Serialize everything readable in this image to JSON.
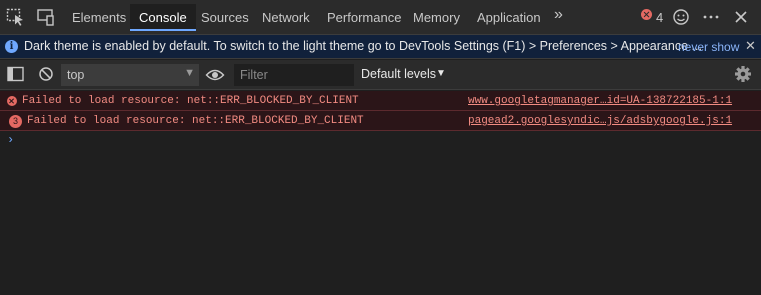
{
  "tabbar": {
    "tabs": [
      {
        "label": "Elements",
        "active": false
      },
      {
        "label": "Console",
        "active": true
      },
      {
        "label": "Sources",
        "active": false
      },
      {
        "label": "Network",
        "active": false
      },
      {
        "label": "Performance",
        "active": false
      },
      {
        "label": "Memory",
        "active": false
      },
      {
        "label": "Application",
        "active": false
      }
    ],
    "more_tabs": "»",
    "error_count": "4",
    "icons": [
      "inspect-element-icon",
      "device-toolbar-icon",
      "error-icon",
      "feedback-icon",
      "kebab-menu-icon",
      "close-icon"
    ]
  },
  "infobar": {
    "text": "Dark theme is enabled by default. To switch to the light theme go to DevTools Settings (F1) > Preferences > Appearance ...",
    "link": "never show",
    "close": "✕"
  },
  "toolbar": {
    "context": "top",
    "filter_placeholder": "Filter",
    "levels": "Default levels",
    "icons": [
      "sidebar-toggle-icon",
      "clear-console-icon",
      "eye-icon",
      "settings-gear-icon"
    ]
  },
  "console": {
    "messages": [
      {
        "text": "Failed to load resource: net::ERR_BLOCKED_BY_CLIENT",
        "source": "www.googletagmanager…id=UA-138722185-1:1",
        "count": ""
      },
      {
        "text": "Failed to load resource: net::ERR_BLOCKED_BY_CLIENT",
        "source": "pagead2.googlesyndic…js/adsbygoogle.js:1",
        "count": "3"
      }
    ],
    "prompt": "›"
  },
  "colors": {
    "accent": "#6fa8ff",
    "error": "#f28b82",
    "background": "#1f1f1f"
  }
}
